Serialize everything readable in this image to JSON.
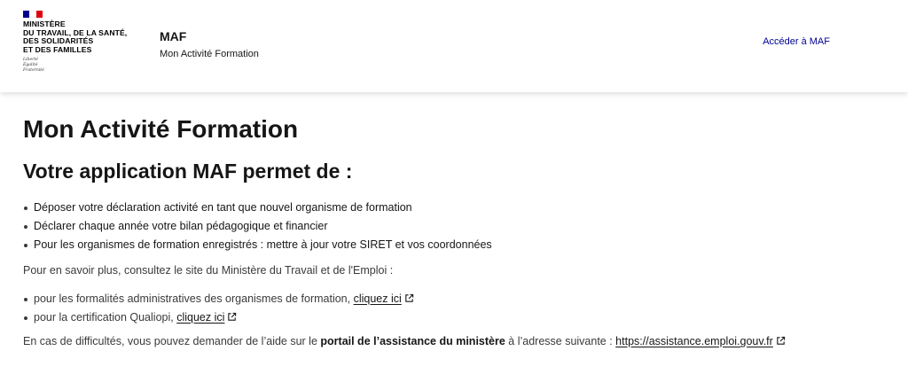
{
  "header": {
    "ministry_lines": [
      "MINISTÈRE",
      "DU TRAVAIL, DE LA SANTÉ,",
      "DES SOLIDARITÉS",
      "ET DES FAMILLES"
    ],
    "motto_lines": [
      "Liberté",
      "Égalité",
      "Fraternité"
    ],
    "service_title": "MAF",
    "service_tagline": "Mon Activité Formation",
    "access_link": "Accéder à MAF"
  },
  "main": {
    "title": "Mon Activité Formation",
    "subtitle": "Votre application MAF permet de :",
    "features": [
      "Déposer votre déclaration activité en tant que nouvel organisme de formation",
      "Déclarer chaque année votre bilan pédagogique et financier",
      "Pour les organismes de formation enregistrés : mettre à jour votre SIRET et vos coordonnées"
    ],
    "info_text": "Pour en savoir plus, consultez le site du Ministère du Travail et de l'Emploi :",
    "links": [
      {
        "prefix": "pour les formalités administratives des organismes de formation, ",
        "link": "cliquez ici"
      },
      {
        "prefix": "pour la certification Qualiopi, ",
        "link": "cliquez ici"
      }
    ],
    "help": {
      "before": "En cas de difficultés, vous pouvez demander de l’aide sur le ",
      "strong": "portail de l’assistance du ministère",
      "after": " à l’adresse suivante : ",
      "link": "https://assistance.emploi.gouv.fr"
    }
  },
  "icons": {
    "external": "external-link-icon",
    "flag": "french-flag-icon"
  },
  "colors": {
    "primary_blue": "#000091",
    "text": "#161616",
    "flag_red": "#e1000f"
  }
}
